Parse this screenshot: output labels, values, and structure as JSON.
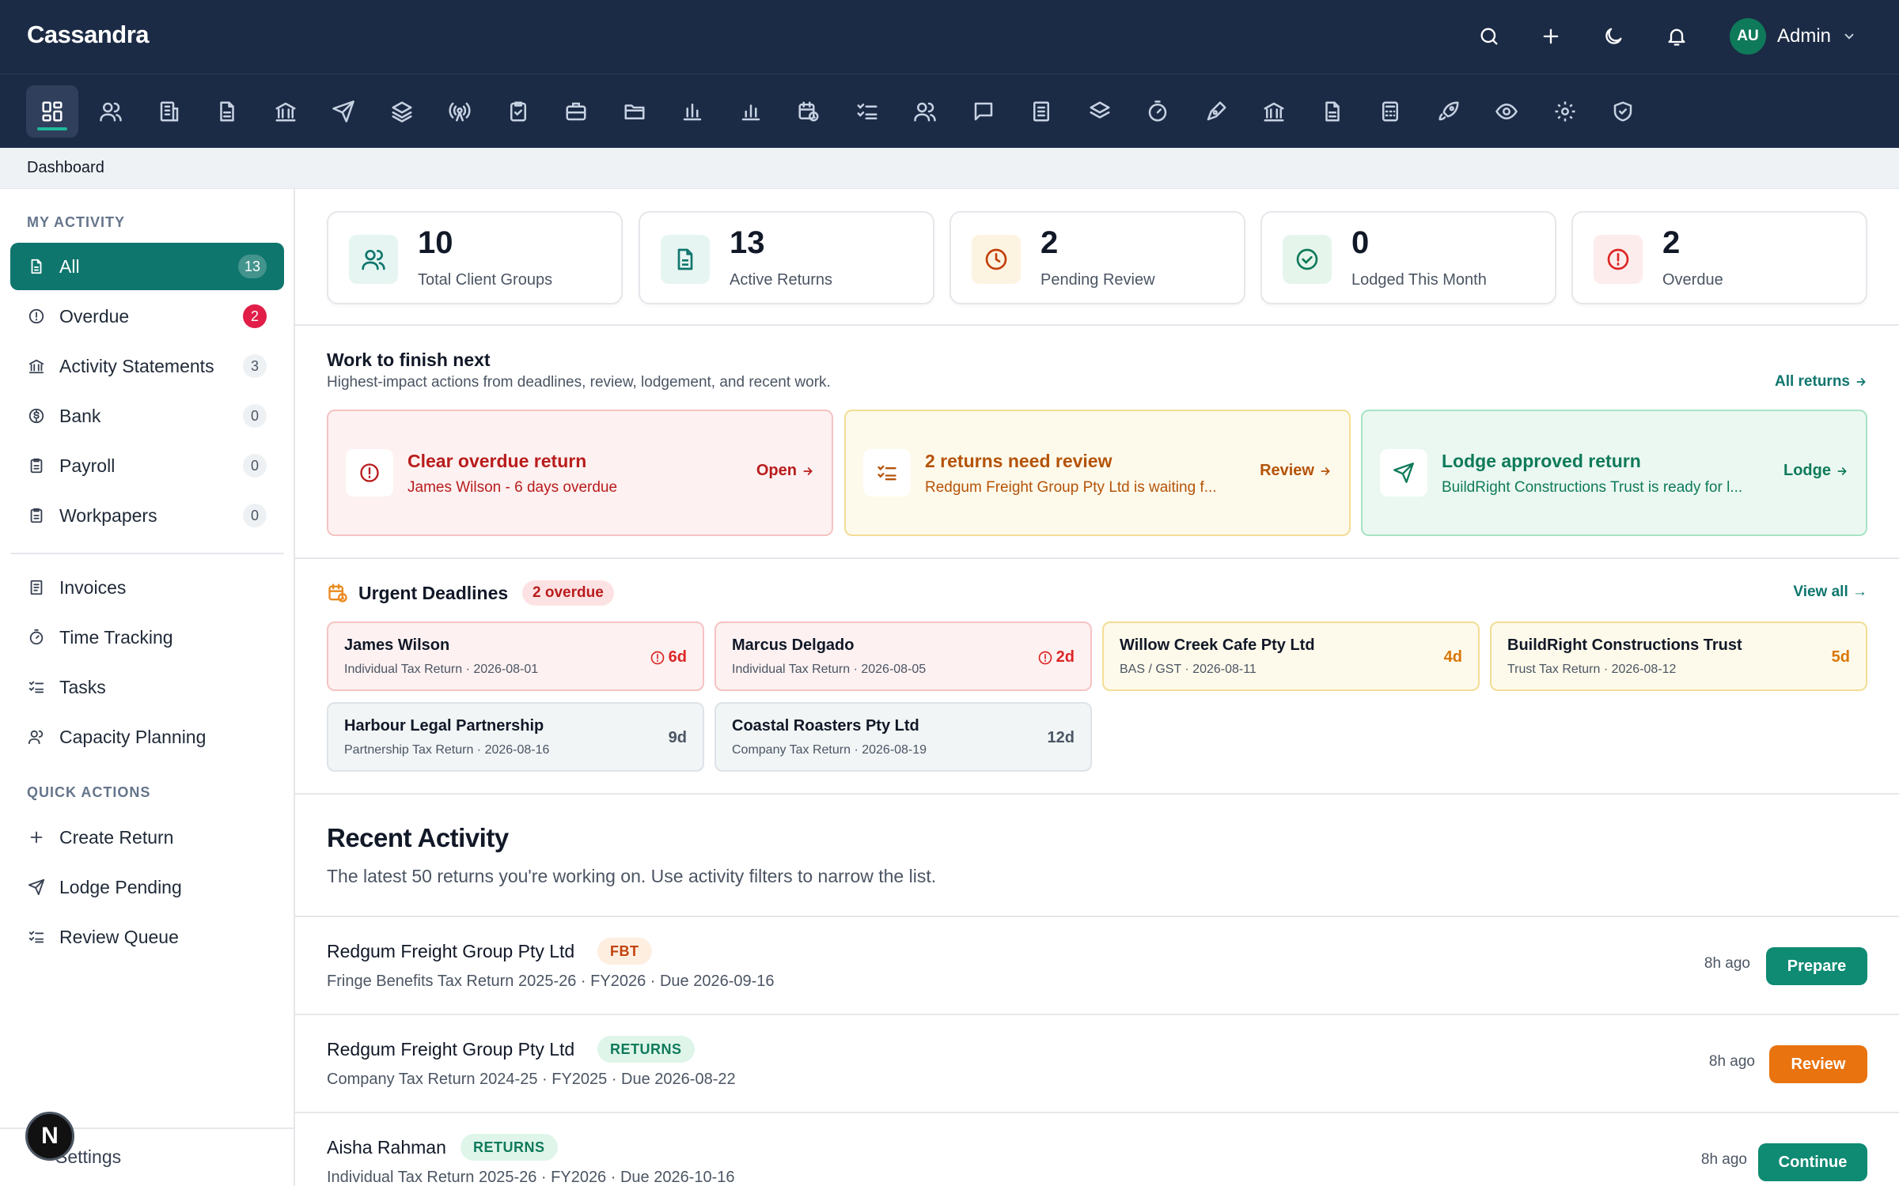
{
  "app": {
    "brand": "Cassandra"
  },
  "user": {
    "initials": "AU",
    "name": "Admin"
  },
  "breadcrumb": "Dashboard",
  "sidebar": {
    "my_activity_heading": "MY ACTIVITY",
    "activity_items": [
      {
        "label": "All",
        "count": "13"
      },
      {
        "label": "Overdue",
        "count": "2"
      },
      {
        "label": "Activity Statements",
        "count": "3"
      },
      {
        "label": "Bank",
        "count": "0"
      },
      {
        "label": "Payroll",
        "count": "0"
      },
      {
        "label": "Workpapers",
        "count": "0"
      }
    ],
    "tool_items": [
      {
        "label": "Invoices"
      },
      {
        "label": "Time Tracking"
      },
      {
        "label": "Tasks"
      },
      {
        "label": "Capacity Planning"
      }
    ],
    "quick_actions_heading": "QUICK ACTIONS",
    "quick_actions": [
      {
        "label": "Create Return"
      },
      {
        "label": "Lodge Pending"
      },
      {
        "label": "Review Queue"
      }
    ],
    "settings_label": "Settings",
    "fab_label": "N"
  },
  "stats": [
    {
      "value": "10",
      "label": "Total Client Groups",
      "icon": "users-icon"
    },
    {
      "value": "13",
      "label": "Active Returns",
      "icon": "document-icon"
    },
    {
      "value": "2",
      "label": "Pending Review",
      "icon": "clock-icon"
    },
    {
      "value": "0",
      "label": "Lodged This Month",
      "icon": "check-circle-icon"
    },
    {
      "value": "2",
      "label": "Overdue",
      "icon": "alert-icon"
    }
  ],
  "work_next": {
    "title": "Work to finish next",
    "subtitle": "Highest-impact actions from deadlines, review, lodgement, and recent work.",
    "all_returns_label": "All returns",
    "cards": [
      {
        "title": "Clear overdue return",
        "subtitle": "James Wilson - 6 days overdue",
        "action": "Open"
      },
      {
        "title": "2 returns need review",
        "subtitle": "Redgum Freight Group Pty Ltd is waiting f...",
        "action": "Review"
      },
      {
        "title": "Lodge approved return",
        "subtitle": "BuildRight Constructions Trust is ready for l...",
        "action": "Lodge"
      }
    ]
  },
  "deadlines": {
    "title": "Urgent Deadlines",
    "badge": "2 overdue",
    "view_all_label": "View all →",
    "items": [
      {
        "name": "James Wilson",
        "detail": "Individual Tax Return · 2026-08-01",
        "days": "6d",
        "status": "overdue"
      },
      {
        "name": "Marcus Delgado",
        "detail": "Individual Tax Return · 2026-08-05",
        "days": "2d",
        "status": "overdue"
      },
      {
        "name": "Willow Creek Cafe Pty Ltd",
        "detail": "BAS / GST · 2026-08-11",
        "days": "4d",
        "status": "soon"
      },
      {
        "name": "BuildRight Constructions Trust",
        "detail": "Trust Tax Return · 2026-08-12",
        "days": "5d",
        "status": "soon"
      },
      {
        "name": "Harbour Legal Partnership",
        "detail": "Partnership Tax Return · 2026-08-16",
        "days": "9d",
        "status": "normal"
      },
      {
        "name": "Coastal Roasters Pty Ltd",
        "detail": "Company Tax Return · 2026-08-19",
        "days": "12d",
        "status": "normal"
      }
    ]
  },
  "recent_activity": {
    "title": "Recent Activity",
    "subtitle": "The latest 50 returns you're working on. Use activity filters to narrow the list.",
    "rows": [
      {
        "name": "Redgum Freight Group Pty Ltd",
        "tag": "FBT",
        "detail": "Fringe Benefits Tax Return 2025-26 · FY2026 · Due 2026-09-16",
        "time": "8h ago",
        "action": "Prepare"
      },
      {
        "name": "Redgum Freight Group Pty Ltd",
        "tag": "RETURNS",
        "detail": "Company Tax Return 2024-25 · FY2025 · Due 2026-08-22",
        "time": "8h ago",
        "action": "Review"
      },
      {
        "name": "Aisha Rahman",
        "tag": "RETURNS",
        "detail": "Individual Tax Return 2025-26 · FY2026 · Due 2026-10-16",
        "time": "8h ago",
        "action": "Continue"
      }
    ]
  },
  "colors": {
    "topbar": "#1c2b45",
    "accent": "#0f766e",
    "danger": "#b91c1c",
    "warning": "#c2410c",
    "success": "#0f7a5a"
  }
}
